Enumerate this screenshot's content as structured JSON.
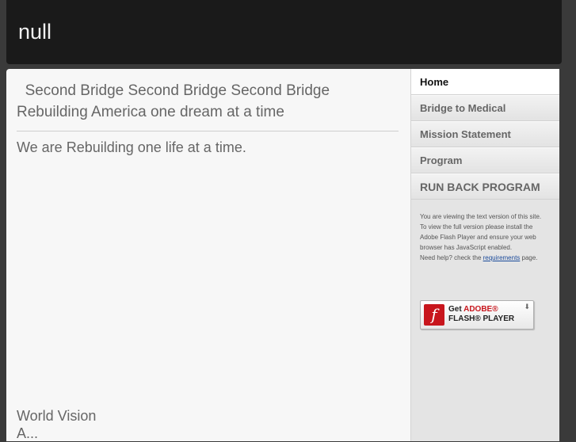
{
  "header": {
    "site_title": "null"
  },
  "main": {
    "headline": "  Second Bridge Second Bridge Second Bridge Rebuilding America one dream at a time",
    "tagline": "We are Rebuilding one life at a time.",
    "footer_line1": "World Vision",
    "footer_line2": "A..."
  },
  "sidebar": {
    "nav": [
      {
        "label": "Home",
        "active": true
      },
      {
        "label": "Bridge to Medical"
      },
      {
        "label": "Mission Statement"
      },
      {
        "label": "Program"
      },
      {
        "label": "RUN BACK PROGRAM"
      }
    ],
    "flash_note": {
      "line1": "You are viewing the text version of this site.",
      "line2": "To view the full version please install the Adobe Flash Player and ensure your web browser has JavaScript enabled.",
      "line3_prefix": "Need help? check the ",
      "line3_link": "requirements",
      "line3_suffix": " page."
    },
    "flash_button": {
      "get": "Get",
      "adobe": "ADOBE®",
      "player": "FLASH® PLAYER",
      "logo_glyph": "f",
      "arrow_glyph": "⬇"
    }
  },
  "colors": {
    "header_bg": "#1a1a1a",
    "page_bg": "#3a3a3a",
    "content_bg": "#f7f7f7",
    "sidebar_bg": "#e4e4e4",
    "flash_red": "#c8161d"
  }
}
